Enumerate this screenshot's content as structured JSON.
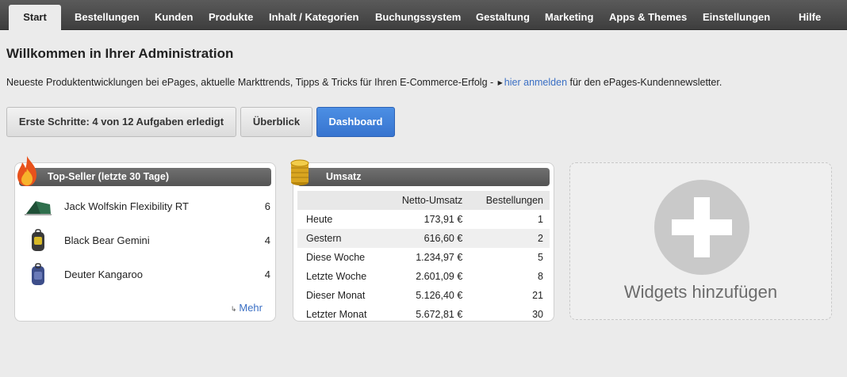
{
  "nav": {
    "items": [
      {
        "label": "Start",
        "active": true
      },
      {
        "label": "Bestellungen"
      },
      {
        "label": "Kunden"
      },
      {
        "label": "Produkte"
      },
      {
        "label": "Inhalt / Kategorien"
      },
      {
        "label": "Buchungssystem"
      },
      {
        "label": "Gestaltung"
      },
      {
        "label": "Marketing"
      },
      {
        "label": "Apps & Themes"
      },
      {
        "label": "Einstellungen"
      },
      {
        "label": "Hilfe"
      }
    ]
  },
  "page": {
    "title": "Willkommen in Ihrer Administration",
    "intro_before": "Neueste Produktentwicklungen bei ePages, aktuelle Markttrends, Tipps & Tricks für Ihren E-Commerce-Erfolg - ",
    "intro_link": "hier anmelden",
    "intro_after": " für den ePages-Kundennewsletter."
  },
  "buttons": {
    "first_steps": "Erste Schritte: 4 von 12 Aufgaben erledigt",
    "overview": "Überblick",
    "dashboard": "Dashboard"
  },
  "topseller": {
    "title": "Top-Seller (letzte 30 Tage)",
    "items": [
      {
        "name": "Jack Wolfskin Flexibility RT",
        "qty": "6",
        "icon": "tent-icon"
      },
      {
        "name": "Black Bear Gemini",
        "qty": "4",
        "icon": "backpack-icon"
      },
      {
        "name": "Deuter Kangaroo",
        "qty": "4",
        "icon": "backpack-icon"
      }
    ],
    "more": "Mehr"
  },
  "umsatz": {
    "title": "Umsatz",
    "headers": [
      "",
      "Netto-Umsatz",
      "Bestellungen"
    ],
    "rows": [
      [
        "Heute",
        "173,91 €",
        "1"
      ],
      [
        "Gestern",
        "616,60 €",
        "2"
      ],
      [
        "Diese Woche",
        "1.234,97 €",
        "5"
      ],
      [
        "Letzte Woche",
        "2.601,09 €",
        "8"
      ],
      [
        "Dieser Monat",
        "5.126,40 €",
        "21"
      ],
      [
        "Letzter Monat",
        "5.672,81 €",
        "30"
      ]
    ]
  },
  "add_widget": {
    "label": "Widgets hinzufügen"
  },
  "colors": {
    "nav_bg": "#4a4a4a",
    "link": "#3a6fc4",
    "primary": "#3e7fda"
  }
}
